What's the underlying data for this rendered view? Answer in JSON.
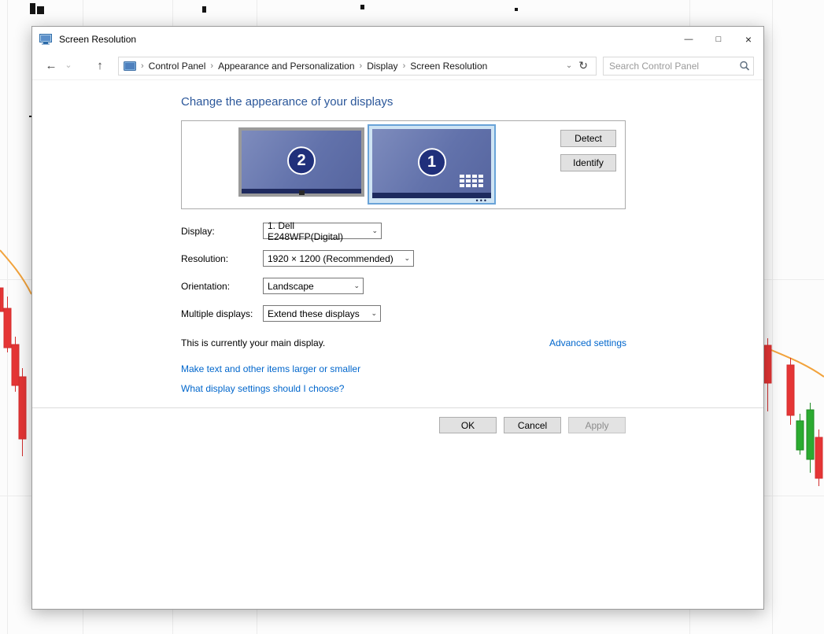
{
  "window": {
    "title": "Screen Resolution",
    "controls": {
      "minimize": "—",
      "maximize": "□",
      "close": "×"
    }
  },
  "icons": {
    "back": "←",
    "forward_chevron": "⌄",
    "up": "↑",
    "crumb_separator": "›",
    "crumb_chevron": "⌄",
    "refresh": "↻",
    "dropdown_chevron": "⌄",
    "monitor_dots": "•••",
    "search": "magnifier"
  },
  "nav": {
    "breadcrumb": [
      "Control Panel",
      "Appearance and Personalization",
      "Display",
      "Screen Resolution"
    ],
    "search_placeholder": "Search Control Panel"
  },
  "content": {
    "heading": "Change the appearance of your displays",
    "monitors": [
      {
        "number": "2"
      },
      {
        "number": "1"
      }
    ],
    "detect_label": "Detect",
    "identify_label": "Identify",
    "fields": [
      {
        "label": "Display:",
        "value": "1. Dell E248WFP(Digital)"
      },
      {
        "label": "Resolution:",
        "value": "1920 × 1200 (Recommended)"
      },
      {
        "label": "Orientation:",
        "value": "Landscape"
      },
      {
        "label": "Multiple displays:",
        "value": "Extend these displays"
      }
    ],
    "main_display_note": "This is currently your main display.",
    "advanced_settings_link": "Advanced settings",
    "links": [
      "Make text and other items larger or smaller",
      "What display settings should I choose?"
    ],
    "buttons": {
      "ok": "OK",
      "cancel": "Cancel",
      "apply": "Apply"
    }
  }
}
